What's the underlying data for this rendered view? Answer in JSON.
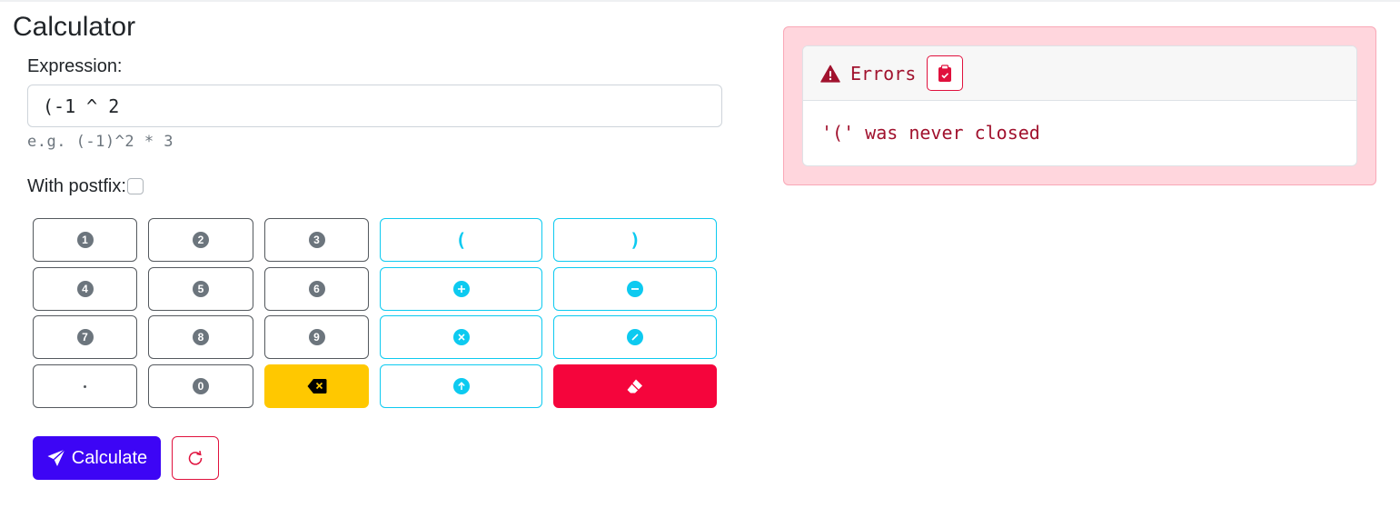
{
  "page": {
    "title": "Calculator"
  },
  "expression": {
    "label": "Expression:",
    "value": "(-1 ^ 2",
    "hint": "e.g. (-1)^2 * 3"
  },
  "postfix": {
    "label": "With postfix:",
    "checked": false
  },
  "keypad": {
    "digits": [
      "1",
      "2",
      "3",
      "4",
      "5",
      "6",
      "7",
      "8",
      "9",
      "0"
    ],
    "open_paren": "(",
    "close_paren": ")",
    "icons": {
      "plus": "plus-circle-icon",
      "minus": "dash-circle-icon",
      "times": "x-circle-icon",
      "divide": "slash-circle-icon",
      "power": "arrow-up-circle-icon",
      "backspace": "backspace-icon",
      "clear": "eraser-icon",
      "decimal": "dot-icon"
    }
  },
  "actions": {
    "calculate_label": "Calculate",
    "reset_icon": "arrow-clockwise-icon"
  },
  "errors": {
    "title": "Errors",
    "message": "'(' was never closed"
  },
  "colors": {
    "primary": "#3d05f5",
    "info": "#0dcaf0",
    "warning": "#ffc800",
    "danger": "#f5053c",
    "error_text": "#a1122e",
    "error_bg": "#ffd6dd"
  }
}
